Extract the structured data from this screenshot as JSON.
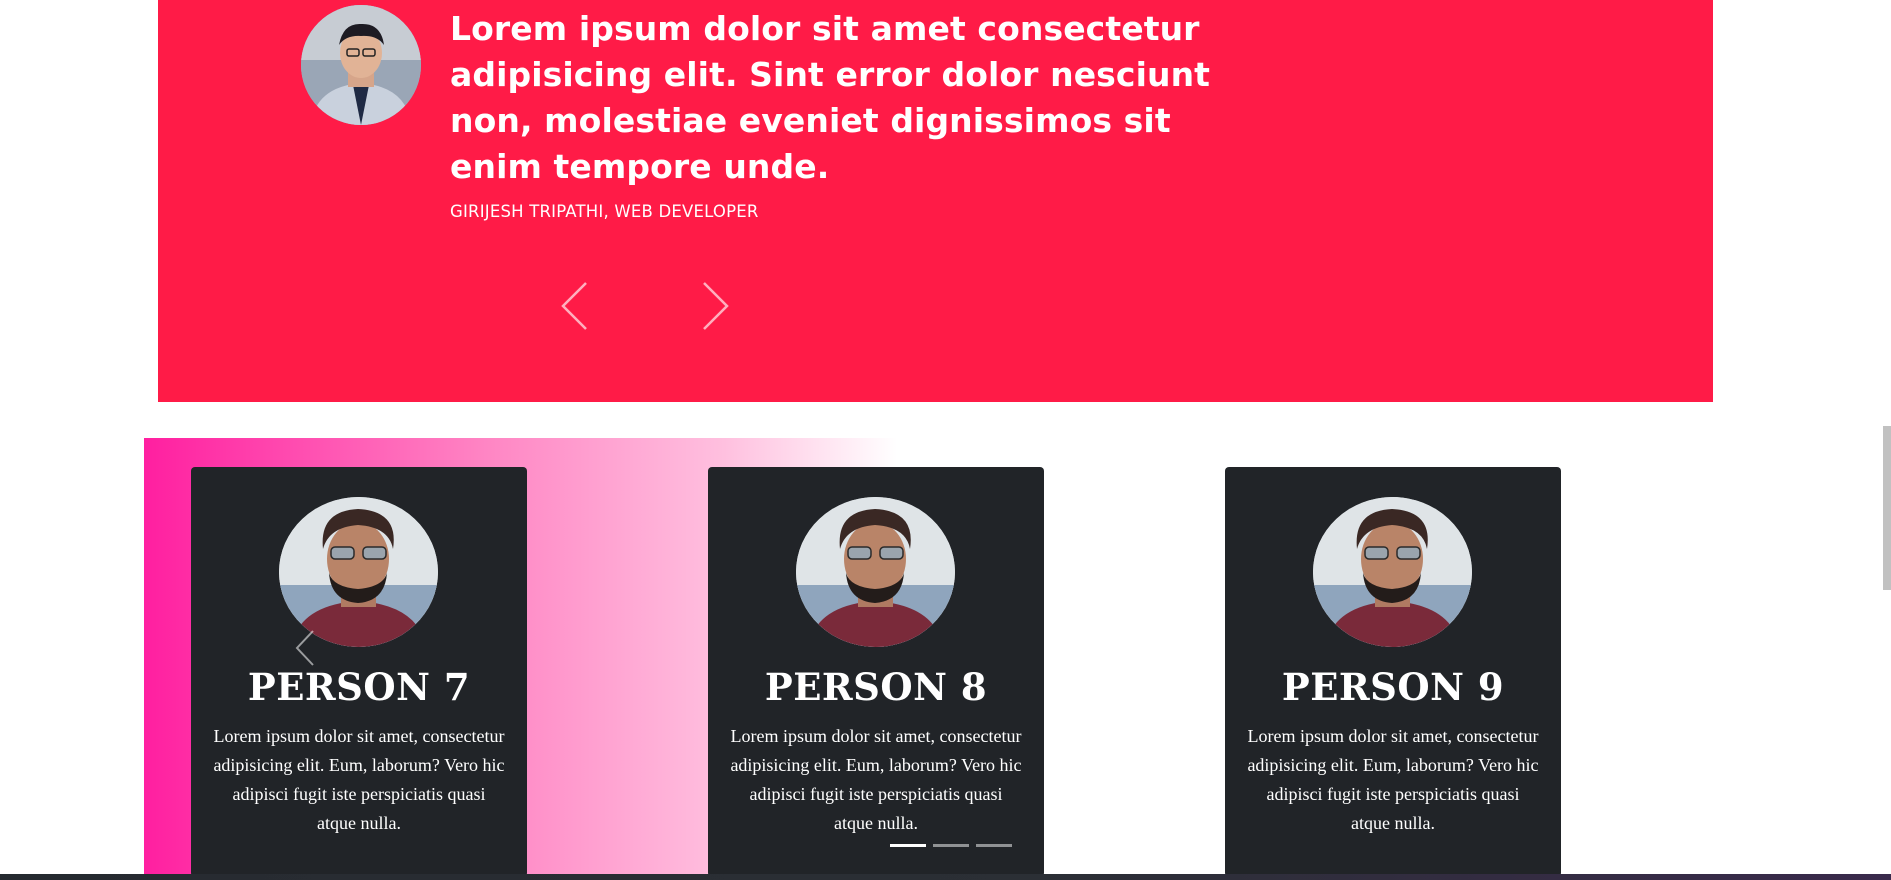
{
  "testimonial": {
    "quote": "Lorem ipsum dolor sit amet consectetur adipisicing elit. Sint error dolor nesciunt non, molestiae eveniet dignissimos sit enim tempore unde.",
    "author": "GIRIJESH TRIPATHI, WEB DEVELOPER",
    "background_color": "#ff1b47",
    "prev_icon": "chevron-left-icon",
    "next_icon": "chevron-right-icon"
  },
  "team": {
    "gradient_color": "#ff1fa0",
    "card_color": "#212428",
    "prev_icon": "chevron-left-icon",
    "cards": [
      {
        "name": "PERSON 7",
        "text": "Lorem ipsum dolor sit amet, consectetur adipisicing elit. Eum, laborum? Vero hic adipisci fugit iste perspiciatis quasi atque nulla."
      },
      {
        "name": "PERSON 8",
        "text": "Lorem ipsum dolor sit amet, consectetur adipisicing elit. Eum, laborum? Vero hic adipisci fugit iste perspiciatis quasi atque nulla."
      },
      {
        "name": "PERSON 9",
        "text": "Lorem ipsum dolor sit amet, consectetur adipisicing elit. Eum, laborum? Vero hic adipisci fugit iste perspiciatis quasi atque nulla."
      }
    ],
    "indicators": {
      "count": 3,
      "active_index": 0
    }
  }
}
